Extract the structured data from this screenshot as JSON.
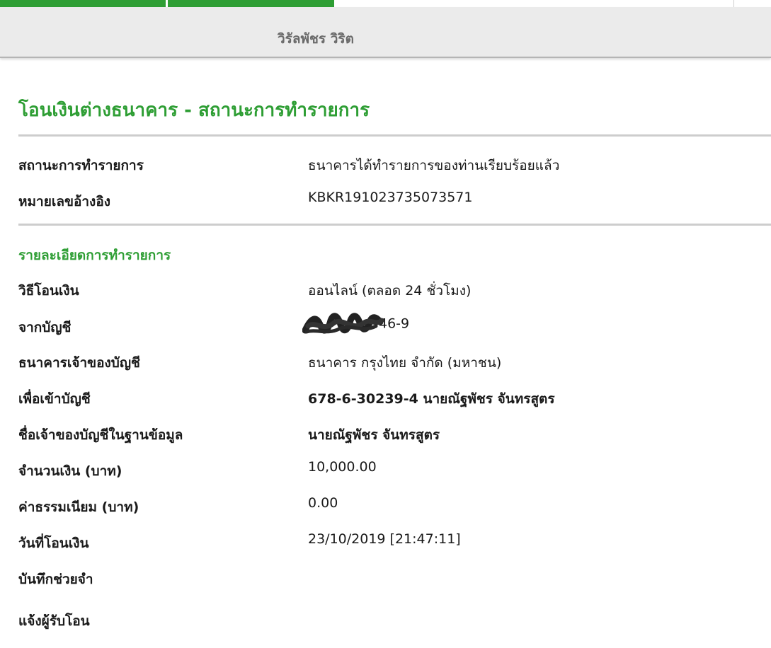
{
  "header": {
    "username": "วิรัลพัชร วิริต"
  },
  "page": {
    "title": "โอนเงินต่างธนาคาร - สถานะการทำรายการ"
  },
  "status": {
    "status_label": "สถานะการทำรายการ",
    "status_value": "ธนาคารได้ทำรายการของท่านเรียบร้อยแล้ว",
    "reference_label": "หมายเลขอ้างอิง",
    "reference_value": "KBKR191023735073571"
  },
  "details": {
    "section_title": "รายละเอียดการทำรายการ",
    "method_label": "วิธีโอนเงิน",
    "method_value": "ออนไลน์ (ตลอด 24 ชั่วโมง)",
    "from_account_label": "จากบัญชี",
    "from_account_value_suffix": "46-9",
    "bank_label": "ธนาคารเจ้าของบัญชี",
    "bank_value": "ธนาคาร กรุงไทย จำกัด (มหาชน)",
    "to_account_label": "เพื่อเข้าบัญชี",
    "to_account_value": "678-6-30239-4 นายณัฐพัชร จันทรสูตร",
    "account_holder_label": "ชื่อเจ้าของบัญชีในฐานข้อมูล",
    "account_holder_value": "นายณัฐพัชร จันทรสูตร",
    "amount_label": "จำนวนเงิน (บาท)",
    "amount_value": "10,000.00",
    "fee_label": "ค่าธรรมเนียม (บาท)",
    "fee_value": "0.00",
    "date_label": "วันที่โอนเงิน",
    "date_value": "23/10/2019 [21:47:11]",
    "memo_label": "บันทึกช่วยจำ",
    "notify_label": "แจ้งผู้รับโอน"
  },
  "colors": {
    "accent_green": "#2e9e34",
    "header_gray": "#ebebeb",
    "rule_gray": "#cdcdcd"
  }
}
